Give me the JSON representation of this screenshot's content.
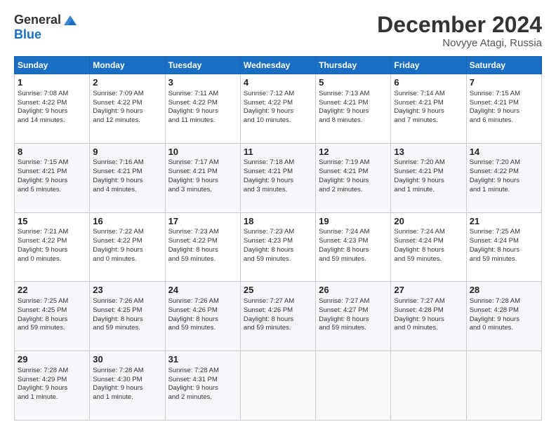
{
  "header": {
    "logo_general": "General",
    "logo_blue": "Blue",
    "month_title": "December 2024",
    "subtitle": "Novyye Atagi, Russia"
  },
  "days_of_week": [
    "Sunday",
    "Monday",
    "Tuesday",
    "Wednesday",
    "Thursday",
    "Friday",
    "Saturday"
  ],
  "weeks": [
    [
      {
        "day": "1",
        "lines": [
          "Sunrise: 7:08 AM",
          "Sunset: 4:22 PM",
          "Daylight: 9 hours",
          "and 14 minutes."
        ]
      },
      {
        "day": "2",
        "lines": [
          "Sunrise: 7:09 AM",
          "Sunset: 4:22 PM",
          "Daylight: 9 hours",
          "and 12 minutes."
        ]
      },
      {
        "day": "3",
        "lines": [
          "Sunrise: 7:11 AM",
          "Sunset: 4:22 PM",
          "Daylight: 9 hours",
          "and 11 minutes."
        ]
      },
      {
        "day": "4",
        "lines": [
          "Sunrise: 7:12 AM",
          "Sunset: 4:22 PM",
          "Daylight: 9 hours",
          "and 10 minutes."
        ]
      },
      {
        "day": "5",
        "lines": [
          "Sunrise: 7:13 AM",
          "Sunset: 4:21 PM",
          "Daylight: 9 hours",
          "and 8 minutes."
        ]
      },
      {
        "day": "6",
        "lines": [
          "Sunrise: 7:14 AM",
          "Sunset: 4:21 PM",
          "Daylight: 9 hours",
          "and 7 minutes."
        ]
      },
      {
        "day": "7",
        "lines": [
          "Sunrise: 7:15 AM",
          "Sunset: 4:21 PM",
          "Daylight: 9 hours",
          "and 6 minutes."
        ]
      }
    ],
    [
      {
        "day": "8",
        "lines": [
          "Sunrise: 7:15 AM",
          "Sunset: 4:21 PM",
          "Daylight: 9 hours",
          "and 5 minutes."
        ]
      },
      {
        "day": "9",
        "lines": [
          "Sunrise: 7:16 AM",
          "Sunset: 4:21 PM",
          "Daylight: 9 hours",
          "and 4 minutes."
        ]
      },
      {
        "day": "10",
        "lines": [
          "Sunrise: 7:17 AM",
          "Sunset: 4:21 PM",
          "Daylight: 9 hours",
          "and 3 minutes."
        ]
      },
      {
        "day": "11",
        "lines": [
          "Sunrise: 7:18 AM",
          "Sunset: 4:21 PM",
          "Daylight: 9 hours",
          "and 3 minutes."
        ]
      },
      {
        "day": "12",
        "lines": [
          "Sunrise: 7:19 AM",
          "Sunset: 4:21 PM",
          "Daylight: 9 hours",
          "and 2 minutes."
        ]
      },
      {
        "day": "13",
        "lines": [
          "Sunrise: 7:20 AM",
          "Sunset: 4:21 PM",
          "Daylight: 9 hours",
          "and 1 minute."
        ]
      },
      {
        "day": "14",
        "lines": [
          "Sunrise: 7:20 AM",
          "Sunset: 4:22 PM",
          "Daylight: 9 hours",
          "and 1 minute."
        ]
      }
    ],
    [
      {
        "day": "15",
        "lines": [
          "Sunrise: 7:21 AM",
          "Sunset: 4:22 PM",
          "Daylight: 9 hours",
          "and 0 minutes."
        ]
      },
      {
        "day": "16",
        "lines": [
          "Sunrise: 7:22 AM",
          "Sunset: 4:22 PM",
          "Daylight: 9 hours",
          "and 0 minutes."
        ]
      },
      {
        "day": "17",
        "lines": [
          "Sunrise: 7:23 AM",
          "Sunset: 4:22 PM",
          "Daylight: 8 hours",
          "and 59 minutes."
        ]
      },
      {
        "day": "18",
        "lines": [
          "Sunrise: 7:23 AM",
          "Sunset: 4:23 PM",
          "Daylight: 8 hours",
          "and 59 minutes."
        ]
      },
      {
        "day": "19",
        "lines": [
          "Sunrise: 7:24 AM",
          "Sunset: 4:23 PM",
          "Daylight: 8 hours",
          "and 59 minutes."
        ]
      },
      {
        "day": "20",
        "lines": [
          "Sunrise: 7:24 AM",
          "Sunset: 4:24 PM",
          "Daylight: 8 hours",
          "and 59 minutes."
        ]
      },
      {
        "day": "21",
        "lines": [
          "Sunrise: 7:25 AM",
          "Sunset: 4:24 PM",
          "Daylight: 8 hours",
          "and 59 minutes."
        ]
      }
    ],
    [
      {
        "day": "22",
        "lines": [
          "Sunrise: 7:25 AM",
          "Sunset: 4:25 PM",
          "Daylight: 8 hours",
          "and 59 minutes."
        ]
      },
      {
        "day": "23",
        "lines": [
          "Sunrise: 7:26 AM",
          "Sunset: 4:25 PM",
          "Daylight: 8 hours",
          "and 59 minutes."
        ]
      },
      {
        "day": "24",
        "lines": [
          "Sunrise: 7:26 AM",
          "Sunset: 4:26 PM",
          "Daylight: 8 hours",
          "and 59 minutes."
        ]
      },
      {
        "day": "25",
        "lines": [
          "Sunrise: 7:27 AM",
          "Sunset: 4:26 PM",
          "Daylight: 8 hours",
          "and 59 minutes."
        ]
      },
      {
        "day": "26",
        "lines": [
          "Sunrise: 7:27 AM",
          "Sunset: 4:27 PM",
          "Daylight: 8 hours",
          "and 59 minutes."
        ]
      },
      {
        "day": "27",
        "lines": [
          "Sunrise: 7:27 AM",
          "Sunset: 4:28 PM",
          "Daylight: 9 hours",
          "and 0 minutes."
        ]
      },
      {
        "day": "28",
        "lines": [
          "Sunrise: 7:28 AM",
          "Sunset: 4:28 PM",
          "Daylight: 9 hours",
          "and 0 minutes."
        ]
      }
    ],
    [
      {
        "day": "29",
        "lines": [
          "Sunrise: 7:28 AM",
          "Sunset: 4:29 PM",
          "Daylight: 9 hours",
          "and 1 minute."
        ]
      },
      {
        "day": "30",
        "lines": [
          "Sunrise: 7:28 AM",
          "Sunset: 4:30 PM",
          "Daylight: 9 hours",
          "and 1 minute."
        ]
      },
      {
        "day": "31",
        "lines": [
          "Sunrise: 7:28 AM",
          "Sunset: 4:31 PM",
          "Daylight: 9 hours",
          "and 2 minutes."
        ]
      },
      null,
      null,
      null,
      null
    ]
  ]
}
